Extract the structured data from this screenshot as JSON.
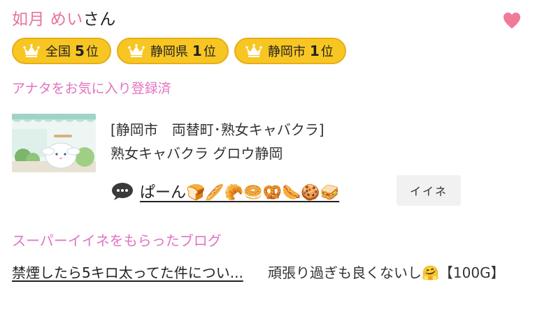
{
  "user": {
    "name": "如月 めい",
    "suffix": "さん"
  },
  "badges": [
    {
      "label": "全国",
      "rank": "5",
      "unit": "位"
    },
    {
      "label": "静岡県",
      "rank": "1",
      "unit": "位"
    },
    {
      "label": "静岡市",
      "rank": "1",
      "unit": "位"
    }
  ],
  "favorite_status": "アナタをお気に入り登録済",
  "shop": {
    "category": "[静岡市　両替町･熟女キャバクラ]",
    "name": "熟女キャバクラ グロウ静岡"
  },
  "comment": {
    "text": "ぱーん🍞🥖🥐🥯🥨🌭🍪🥪",
    "iine_label": "イイネ"
  },
  "super_section": {
    "title": "スーパーイイネをもらったブログ",
    "blogs": [
      {
        "title": "禁煙したら5キロ太ってた件につい..."
      },
      {
        "title": "頑張り過ぎも良くないし🤗【100G】"
      }
    ]
  },
  "colors": {
    "pink": "#e8739a",
    "badge": "#f8c623",
    "heart": "#f07a9a"
  },
  "icons": {
    "heart": "heart-icon",
    "crown": "crown-icon",
    "comment": "speech-bubble-icon"
  }
}
